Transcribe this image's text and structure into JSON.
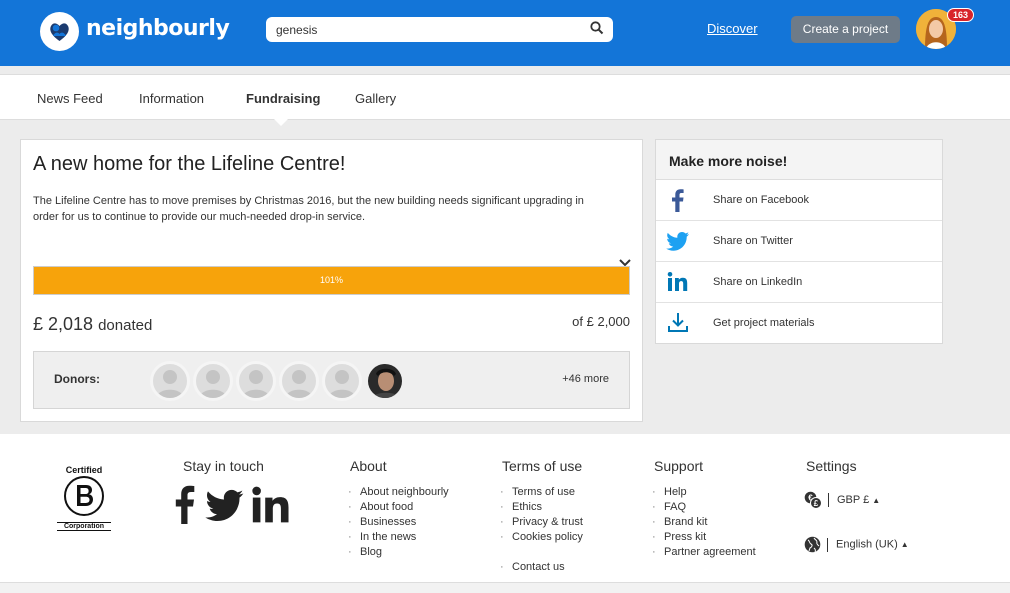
{
  "header": {
    "brand": "neighbourly",
    "search_value": "genesis",
    "discover_label": "Discover",
    "create_label": "Create a project",
    "notification_count": "163"
  },
  "tabs": [
    {
      "label": "News Feed"
    },
    {
      "label": "Information"
    },
    {
      "label": "Fundraising",
      "active": true
    },
    {
      "label": "Gallery"
    }
  ],
  "project": {
    "title": "A new home for the Lifeline Centre!",
    "description": "The Lifeline Centre has to move premises by Christmas 2016, but the new building needs significant upgrading in order for us to continue to provide our much-needed drop-in service.",
    "progress_percent": 101,
    "progress_label": "101%",
    "donated_amount": "£ 2,018",
    "donated_suffix": "donated",
    "goal": "of £ 2,000",
    "donors_label": "Donors:",
    "more_donors": "+46 more"
  },
  "share": {
    "title": "Make more noise!",
    "items": [
      {
        "label": "Share on Facebook",
        "icon": "facebook-icon"
      },
      {
        "label": "Share on Twitter",
        "icon": "twitter-icon"
      },
      {
        "label": "Share on LinkedIn",
        "icon": "linkedin-icon"
      },
      {
        "label": "Get project materials",
        "icon": "download-icon"
      }
    ]
  },
  "footer": {
    "bcorp_certified": "Certified",
    "bcorp_corporation": "Corporation",
    "stay_in_touch": "Stay in touch",
    "about": {
      "title": "About",
      "links": [
        "About neighbourly",
        "About food",
        "Businesses",
        "In the news",
        "Blog"
      ]
    },
    "terms": {
      "title": "Terms of use",
      "links": [
        "Terms of use",
        "Ethics",
        "Privacy & trust",
        "Cookies policy"
      ],
      "extra_link": "Contact us"
    },
    "support": {
      "title": "Support",
      "links": [
        "Help",
        "FAQ",
        "Brand kit",
        "Press kit",
        "Partner agreement"
      ]
    },
    "settings": {
      "title": "Settings",
      "currency": "GBP £",
      "language": "English (UK)"
    }
  },
  "colors": {
    "brand_blue": "#1375d8",
    "progress_orange": "#f7a30b",
    "button_gray": "#6e7b88",
    "badge_red": "#d8242a"
  }
}
